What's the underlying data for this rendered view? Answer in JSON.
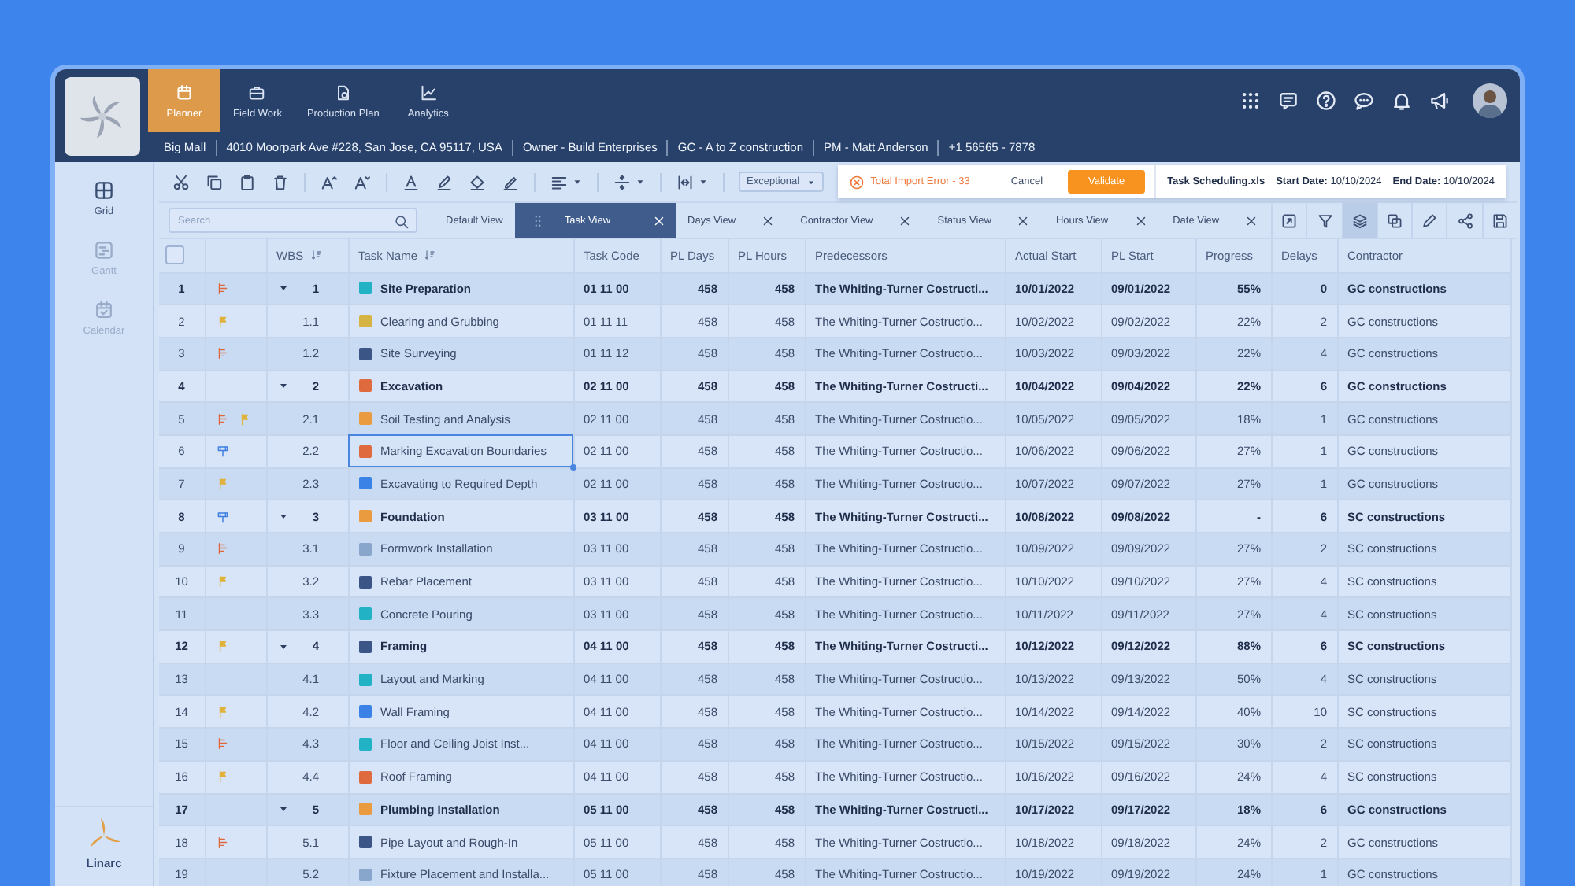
{
  "header": {
    "nav": [
      {
        "label": "Planner",
        "selected": true
      },
      {
        "label": "Field Work",
        "selected": false
      },
      {
        "label": "Production Plan",
        "selected": false
      },
      {
        "label": "Analytics",
        "selected": false
      }
    ],
    "info": [
      "Big Mall",
      "4010 Moorpark Ave #228, San Jose, CA 95117, USA",
      "Owner - Build Enterprises",
      "GC - A to Z construction",
      "PM -  Matt Anderson",
      "+1 56565 - 7878"
    ]
  },
  "sidebar": {
    "items": [
      {
        "label": "Grid",
        "selected": true
      },
      {
        "label": "Gantt",
        "selected": false
      },
      {
        "label": "Calendar",
        "selected": false
      }
    ],
    "brand": "Linarc"
  },
  "toolbar": {
    "filter": "Exceptional",
    "import": {
      "error": "Total Import Error - 33",
      "cancel": "Cancel",
      "validate": "Validate",
      "file": "Task Scheduling.xls",
      "start": "**Start Date:** 10/10/2024",
      "end": "**End Date:** 10/10/2024"
    }
  },
  "views": {
    "search_placeholder": "Search",
    "tabs": [
      {
        "label": "Default View",
        "selected": false,
        "closable": false
      },
      {
        "label": "Task View",
        "selected": true,
        "closable": true
      },
      {
        "label": "Days View",
        "selected": false,
        "closable": true
      },
      {
        "label": "Contractor View",
        "selected": false,
        "closable": true
      },
      {
        "label": "Status View",
        "selected": false,
        "closable": true
      },
      {
        "label": "Hours View",
        "selected": false,
        "closable": true
      },
      {
        "label": "Date View",
        "selected": false,
        "closable": true
      }
    ],
    "tools": [
      {
        "selected": false
      },
      {
        "selected": false
      },
      {
        "selected": true
      },
      {
        "selected": false
      },
      {
        "selected": false
      },
      {
        "selected": false
      },
      {
        "selected": false
      }
    ]
  },
  "table": {
    "select_all": {
      "checked": false
    },
    "columns": [
      {
        "label": "WBS",
        "sortable": true
      },
      {
        "label": "Task Name",
        "sortable": true
      },
      {
        "label": "Task Code",
        "sortable": false
      },
      {
        "label": "PL Days",
        "sortable": false
      },
      {
        "label": "PL Hours",
        "sortable": false
      },
      {
        "label": "Predecessors",
        "sortable": false
      },
      {
        "label": "Actual Start",
        "sortable": false
      },
      {
        "label": "PL Start",
        "sortable": false
      },
      {
        "label": "Progress",
        "sortable": false
      },
      {
        "label": "Delays",
        "sortable": false
      },
      {
        "label": "Contractor",
        "sortable": false
      }
    ],
    "rows": [
      {
        "num": "1",
        "kind": "group",
        "expanded": true,
        "selected": false,
        "markers": [
          {
            "kind": "steps"
          }
        ],
        "wbs": "1",
        "color": "#22b2c6",
        "name": "Site Preparation",
        "code": "01 11 00",
        "days": "458",
        "hours": "458",
        "pred": "The Whiting-Turner Costructi...",
        "actual": "10/01/2022",
        "start": "09/01/2022",
        "progress": "55%",
        "delays": "0",
        "contractor": "GC constructions"
      },
      {
        "num": "2",
        "kind": "task",
        "selected": false,
        "markers": [
          {
            "kind": "flag"
          }
        ],
        "wbs": "1.1",
        "color": "#d6b443",
        "name": "Clearing and Grubbing",
        "code": "01 11 11",
        "days": "458",
        "hours": "458",
        "pred": "The Whiting-Turner Costructio...",
        "actual": "10/02/2022",
        "start": "09/02/2022",
        "progress": "22%",
        "delays": "2",
        "contractor": "GC constructions"
      },
      {
        "num": "3",
        "kind": "task",
        "selected": false,
        "markers": [
          {
            "kind": "steps"
          }
        ],
        "wbs": "1.2",
        "color": "#3b5686",
        "name": "Site Surveying",
        "code": "01 11 12",
        "days": "458",
        "hours": "458",
        "pred": "The Whiting-Turner Costructio...",
        "actual": "10/03/2022",
        "start": "09/03/2022",
        "progress": "22%",
        "delays": "4",
        "contractor": "GC constructions"
      },
      {
        "num": "4",
        "kind": "group",
        "expanded": true,
        "selected": false,
        "markers": [],
        "wbs": "2",
        "color": "#df6a3e",
        "name": "Excavation",
        "code": "02 11 00",
        "days": "458",
        "hours": "458",
        "pred": "The Whiting-Turner Costructi...",
        "actual": "10/04/2022",
        "start": "09/04/2022",
        "progress": "22%",
        "delays": "6",
        "contractor": "GC constructions"
      },
      {
        "num": "5",
        "kind": "task",
        "selected": false,
        "markers": [
          {
            "kind": "steps"
          },
          {
            "kind": "flag"
          }
        ],
        "wbs": "2.1",
        "color": "#eb9b3f",
        "name": "Soil Testing and Analysis",
        "code": "02 11 00",
        "days": "458",
        "hours": "458",
        "pred": "The Whiting-Turner Costructio...",
        "actual": "10/05/2022",
        "start": "09/05/2022",
        "progress": "18%",
        "delays": "1",
        "contractor": "GC constructions"
      },
      {
        "num": "6",
        "kind": "task",
        "selected": true,
        "markers": [
          {
            "kind": "pin"
          }
        ],
        "wbs": "2.2",
        "color": "#df6a3e",
        "name": "Marking Excavation Boundaries",
        "code": "02 11 00",
        "days": "458",
        "hours": "458",
        "pred": "The Whiting-Turner Costructio...",
        "actual": "10/06/2022",
        "start": "09/06/2022",
        "progress": "27%",
        "delays": "1",
        "contractor": "GC constructions"
      },
      {
        "num": "7",
        "kind": "task",
        "selected": false,
        "markers": [
          {
            "kind": "flag"
          }
        ],
        "wbs": "2.3",
        "color": "#3a82e6",
        "name": "Excavating to Required Depth",
        "code": "02 11 00",
        "days": "458",
        "hours": "458",
        "pred": "The Whiting-Turner Costructio...",
        "actual": "10/07/2022",
        "start": "09/07/2022",
        "progress": "27%",
        "delays": "1",
        "contractor": "GC constructions"
      },
      {
        "num": "8",
        "kind": "group",
        "expanded": true,
        "selected": false,
        "markers": [
          {
            "kind": "pin"
          }
        ],
        "wbs": "3",
        "color": "#eb9b3f",
        "name": "Foundation",
        "code": "03 11 00",
        "days": "458",
        "hours": "458",
        "pred": "The Whiting-Turner Costructi...",
        "actual": "10/08/2022",
        "start": "09/08/2022",
        "progress": "-",
        "delays": "6",
        "contractor": "SC constructions"
      },
      {
        "num": "9",
        "kind": "task",
        "selected": false,
        "markers": [
          {
            "kind": "steps"
          }
        ],
        "wbs": "3.1",
        "color": "#88a5cc",
        "name": "Formwork Installation",
        "code": "03 11 00",
        "days": "458",
        "hours": "458",
        "pred": "The Whiting-Turner Costructio...",
        "actual": "10/09/2022",
        "start": "09/09/2022",
        "progress": "27%",
        "delays": "2",
        "contractor": "SC constructions"
      },
      {
        "num": "10",
        "kind": "task",
        "selected": false,
        "markers": [
          {
            "kind": "flag"
          }
        ],
        "wbs": "3.2",
        "color": "#3b5686",
        "name": "Rebar Placement",
        "code": "03 11 00",
        "days": "458",
        "hours": "458",
        "pred": "The Whiting-Turner Costructio...",
        "actual": "10/10/2022",
        "start": "09/10/2022",
        "progress": "27%",
        "delays": "4",
        "contractor": "SC constructions"
      },
      {
        "num": "11",
        "kind": "task",
        "selected": false,
        "markers": [],
        "wbs": "3.3",
        "color": "#22b2c6",
        "name": "Concrete Pouring",
        "code": "03 11 00",
        "days": "458",
        "hours": "458",
        "pred": "The Whiting-Turner Costructio...",
        "actual": "10/11/2022",
        "start": "09/11/2022",
        "progress": "27%",
        "delays": "4",
        "contractor": "SC constructions"
      },
      {
        "num": "12",
        "kind": "group",
        "expanded": true,
        "selected": false,
        "markers": [
          {
            "kind": "flag"
          }
        ],
        "wbs": "4",
        "color": "#3b5686",
        "name": "Framing",
        "code": "04 11 00",
        "days": "458",
        "hours": "458",
        "pred": "The Whiting-Turner Costructi...",
        "actual": "10/12/2022",
        "start": "09/12/2022",
        "progress": "88%",
        "delays": "6",
        "contractor": "SC constructions"
      },
      {
        "num": "13",
        "kind": "task",
        "selected": false,
        "markers": [],
        "wbs": "4.1",
        "color": "#22b2c6",
        "name": "Layout and Marking",
        "code": "04 11 00",
        "days": "458",
        "hours": "458",
        "pred": "The Whiting-Turner Costructio...",
        "actual": "10/13/2022",
        "start": "09/13/2022",
        "progress": "50%",
        "delays": "4",
        "contractor": "SC constructions"
      },
      {
        "num": "14",
        "kind": "task",
        "selected": false,
        "markers": [
          {
            "kind": "flag"
          }
        ],
        "wbs": "4.2",
        "color": "#3a82e6",
        "name": "Wall Framing",
        "code": "04 11 00",
        "days": "458",
        "hours": "458",
        "pred": "The Whiting-Turner Costructio...",
        "actual": "10/14/2022",
        "start": "09/14/2022",
        "progress": "40%",
        "delays": "10",
        "contractor": "SC constructions"
      },
      {
        "num": "15",
        "kind": "task",
        "selected": false,
        "markers": [
          {
            "kind": "steps"
          }
        ],
        "wbs": "4.3",
        "color": "#22b2c6",
        "name": "Floor and Ceiling Joist Inst...",
        "code": "04 11 00",
        "days": "458",
        "hours": "458",
        "pred": "The Whiting-Turner Costructio...",
        "actual": "10/15/2022",
        "start": "09/15/2022",
        "progress": "30%",
        "delays": "2",
        "contractor": "SC constructions"
      },
      {
        "num": "16",
        "kind": "task",
        "selected": false,
        "markers": [
          {
            "kind": "flag"
          }
        ],
        "wbs": "4.4",
        "color": "#df6a3e",
        "name": "Roof Framing",
        "code": "04 11 00",
        "days": "458",
        "hours": "458",
        "pred": "The Whiting-Turner Costructio...",
        "actual": "10/16/2022",
        "start": "09/16/2022",
        "progress": "24%",
        "delays": "4",
        "contractor": "SC constructions"
      },
      {
        "num": "17",
        "kind": "group",
        "expanded": true,
        "selected": false,
        "markers": [],
        "wbs": "5",
        "color": "#eb9b3f",
        "name": "Plumbing Installation",
        "code": "05 11 00",
        "days": "458",
        "hours": "458",
        "pred": "The Whiting-Turner Costructi...",
        "actual": "10/17/2022",
        "start": "09/17/2022",
        "progress": "18%",
        "delays": "6",
        "contractor": "GC constructions"
      },
      {
        "num": "18",
        "kind": "task",
        "selected": false,
        "markers": [
          {
            "kind": "steps"
          }
        ],
        "wbs": "5.1",
        "color": "#3b5686",
        "name": "Pipe Layout and Rough-In",
        "code": "05 11 00",
        "days": "458",
        "hours": "458",
        "pred": "The Whiting-Turner Costructio...",
        "actual": "10/18/2022",
        "start": "09/18/2022",
        "progress": "24%",
        "delays": "2",
        "contractor": "GC constructions"
      },
      {
        "num": "19",
        "kind": "task",
        "selected": false,
        "markers": [],
        "wbs": "5.2",
        "color": "#88a5cc",
        "name": "Fixture Placement and Installa...",
        "code": "05 11 00",
        "days": "458",
        "hours": "458",
        "pred": "The Whiting-Turner Costructio...",
        "actual": "10/19/2022",
        "start": "09/19/2022",
        "progress": "24%",
        "delays": "1",
        "contractor": "GC constructions"
      }
    ]
  }
}
